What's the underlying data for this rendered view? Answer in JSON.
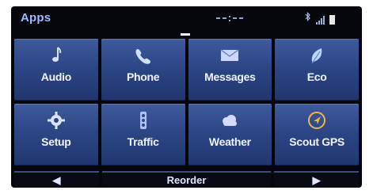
{
  "header": {
    "title": "Apps",
    "bluetooth_icon": "bluetooth-icon",
    "signal_icon": "signal-icon",
    "battery_icon": "battery-icon"
  },
  "apps": [
    {
      "label": "Audio",
      "icon": "music-note-icon"
    },
    {
      "label": "Phone",
      "icon": "phone-icon"
    },
    {
      "label": "Messages",
      "icon": "envelope-icon"
    },
    {
      "label": "Eco",
      "icon": "leaf-icon"
    },
    {
      "label": "Setup",
      "icon": "gear-icon"
    },
    {
      "label": "Traffic",
      "icon": "traffic-light-icon"
    },
    {
      "label": "Weather",
      "icon": "cloud-icon"
    },
    {
      "label": "Scout GPS",
      "icon": "navigation-arrow-icon"
    }
  ],
  "footer": {
    "prev_symbol": "◀",
    "reorder_label": "Reorder",
    "next_symbol": "▶"
  },
  "colors": {
    "tile": "#2c4685",
    "title": "#9fb8ff",
    "label": "#f1f4ff",
    "screen": "#05070d"
  }
}
